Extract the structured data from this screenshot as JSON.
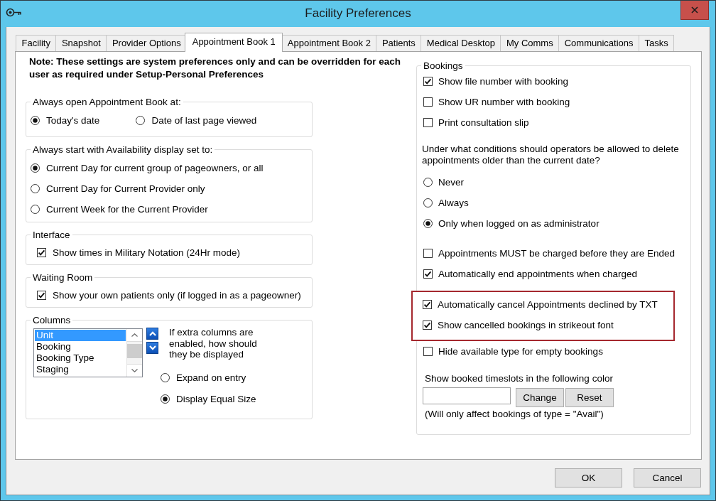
{
  "window": {
    "title": "Facility Preferences"
  },
  "tabs": [
    {
      "label": "Facility",
      "selected": false
    },
    {
      "label": "Snapshot",
      "selected": false
    },
    {
      "label": "Provider Options",
      "selected": false
    },
    {
      "label": "Appointment Book 1",
      "selected": true
    },
    {
      "label": "Appointment Book 2",
      "selected": false
    },
    {
      "label": "Patients",
      "selected": false
    },
    {
      "label": "Medical Desktop",
      "selected": false
    },
    {
      "label": "My Comms",
      "selected": false
    },
    {
      "label": "Communications",
      "selected": false
    },
    {
      "label": "Tasks",
      "selected": false
    }
  ],
  "note": "Note: These settings are system preferences only and can be overridden for each user as required under Setup-Personal Preferences",
  "groups": [
    {
      "kind": "radio-row",
      "title": "Always open Appointment Book at:",
      "options": [
        {
          "label": "Today's date",
          "selected": true
        },
        {
          "label": "Date of last page viewed",
          "selected": false
        }
      ]
    },
    {
      "kind": "radio-list",
      "title": "Always start with Availability display set to:",
      "options": [
        {
          "label": "Current Day for current group of pageowners, or all",
          "selected": true
        },
        {
          "label": "Current Day for Current Provider only",
          "selected": false
        },
        {
          "label": "Current Week for the Current Provider",
          "selected": false
        }
      ]
    },
    {
      "kind": "checkbox-list",
      "title": "Interface",
      "options": [
        {
          "label": "Show times in Military Notation (24Hr mode)",
          "checked": true
        }
      ]
    },
    {
      "kind": "checkbox-list",
      "title": "Waiting Room",
      "options": [
        {
          "label": "Show your own patients only (if logged in as a pageowner)",
          "checked": true
        }
      ]
    },
    {
      "kind": "columns",
      "title": "Columns",
      "list": [
        {
          "label": "Unit",
          "selected": true
        },
        {
          "label": "Booking",
          "selected": false
        },
        {
          "label": "Booking Type",
          "selected": false
        },
        {
          "label": "Staging",
          "selected": false
        }
      ],
      "hint": "If extra columns are enabled, how should they be displayed",
      "options": [
        {
          "label": "Expand on entry",
          "selected": false
        },
        {
          "label": "Display Equal Size",
          "selected": true
        }
      ]
    }
  ],
  "bookings": {
    "title": "Bookings",
    "items": [
      {
        "kind": "checkbox",
        "label": "Show file number with booking",
        "checked": true,
        "highlighted": false
      },
      {
        "kind": "checkbox",
        "label": "Show UR number with booking",
        "checked": false,
        "highlighted": false
      },
      {
        "kind": "checkbox",
        "label": "Print consultation slip",
        "checked": false,
        "highlighted": false
      },
      {
        "kind": "text",
        "text": "Under what conditions should operators be allowed to delete appointments older than the current date?",
        "highlighted": false
      },
      {
        "kind": "radio",
        "label": "Never",
        "selected": false,
        "highlighted": false
      },
      {
        "kind": "radio",
        "label": "Always",
        "selected": false,
        "highlighted": false
      },
      {
        "kind": "radio",
        "label": "Only when logged on as administrator",
        "selected": true,
        "highlighted": false
      },
      {
        "kind": "checkbox",
        "label": "Appointments MUST be charged before they are Ended",
        "checked": false,
        "highlighted": false
      },
      {
        "kind": "checkbox",
        "label": "Automatically end appointments when charged",
        "checked": true,
        "highlighted": false
      },
      {
        "kind": "checkbox",
        "label": "Automatically cancel Appointments declined by TXT",
        "checked": true,
        "highlighted": true
      },
      {
        "kind": "checkbox",
        "label": "Show cancelled bookings in strikeout font",
        "checked": true,
        "highlighted": true
      },
      {
        "kind": "checkbox",
        "label": "Hide available type for empty bookings",
        "checked": false,
        "highlighted": false
      }
    ],
    "color_setting": {
      "label": "Show booked timeslots in the following color",
      "buttons": [
        "Change",
        "Reset"
      ],
      "note": "(Will only affect bookings of type = \"Avail\")"
    }
  },
  "buttons": [
    "OK",
    "Cancel"
  ]
}
